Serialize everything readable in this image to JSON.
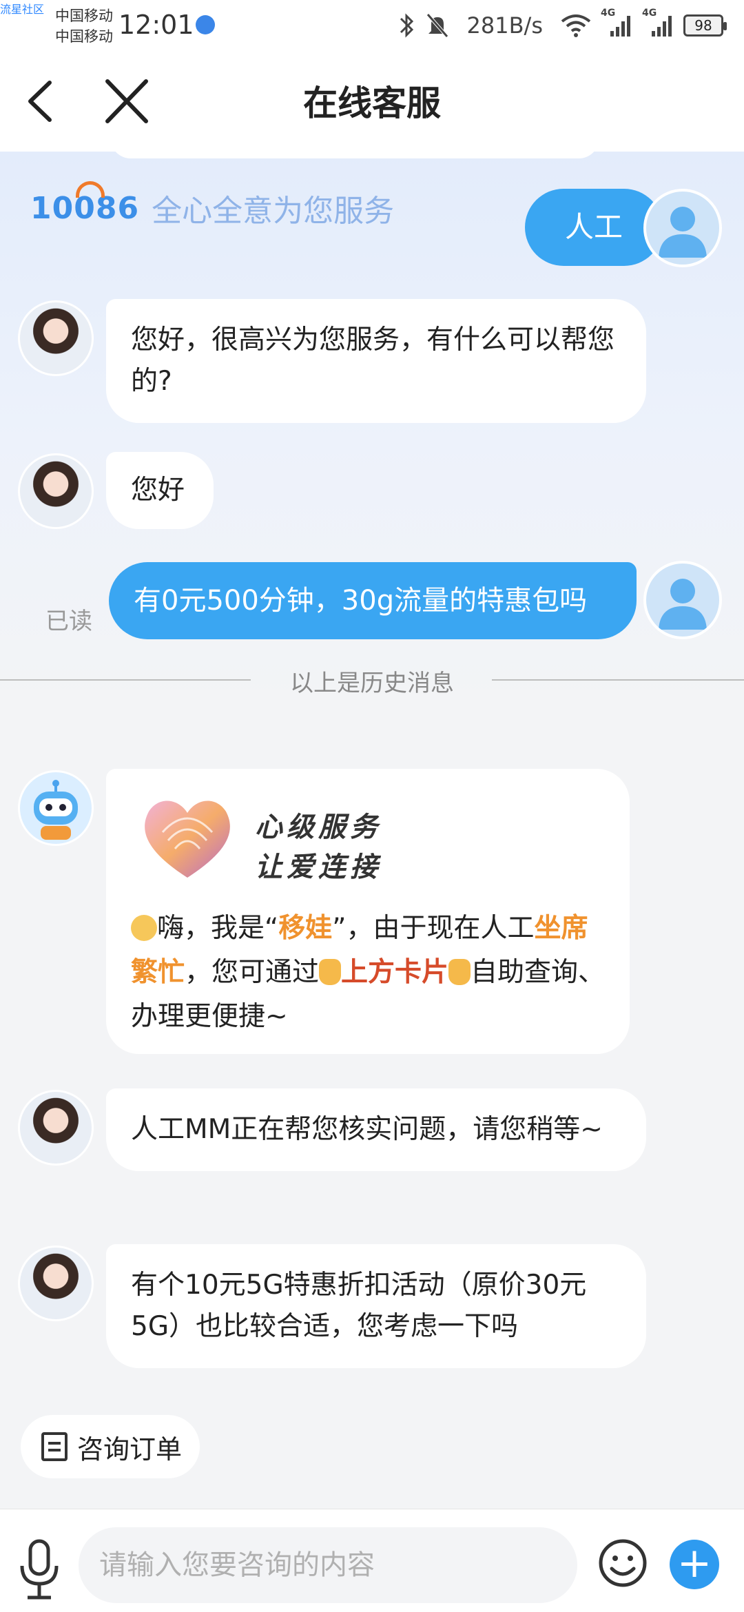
{
  "status": {
    "watermark": "流星社区",
    "carrier1": "中国移动",
    "carrier2": "中国移动",
    "time": "12:01",
    "speed": "281B/s",
    "signal1": "4G",
    "signal2": "4G",
    "battery": "98"
  },
  "header": {
    "title": "在线客服"
  },
  "brand": {
    "logo": "10086",
    "slogan": "全心全意为您服务"
  },
  "messages": {
    "m1": "人工",
    "m2": "您好，很高兴为您服务，有什么可以帮您的?",
    "m3": "您好",
    "m4": "有0元500分钟，30g流量的特惠包吗",
    "read_status": "已读",
    "history_divider": "以上是历史消息",
    "card_line1": "心级服务",
    "card_line2": "让爱连接",
    "card_p1": "嗨，我是“",
    "card_name": "移娃",
    "card_p2": "”，由于现在人工",
    "card_busy": "坐席繁忙",
    "card_p3": "，您可通过",
    "card_link": "上方卡片",
    "card_p4": "自助查询、办理更便捷~",
    "m6": "人工MM正在帮您核实问题，请您稍等~",
    "m7": "有个10元5G特惠折扣活动（原价30元5G）也比较合适，您考虑一下吗"
  },
  "quick_chip": {
    "label": "咨询订单"
  },
  "input": {
    "placeholder": "请输入您要咨询的内容"
  },
  "colors": {
    "accent": "#3aa6f2",
    "highlight_orange": "#f0922e",
    "highlight_red": "#d64b2a"
  }
}
